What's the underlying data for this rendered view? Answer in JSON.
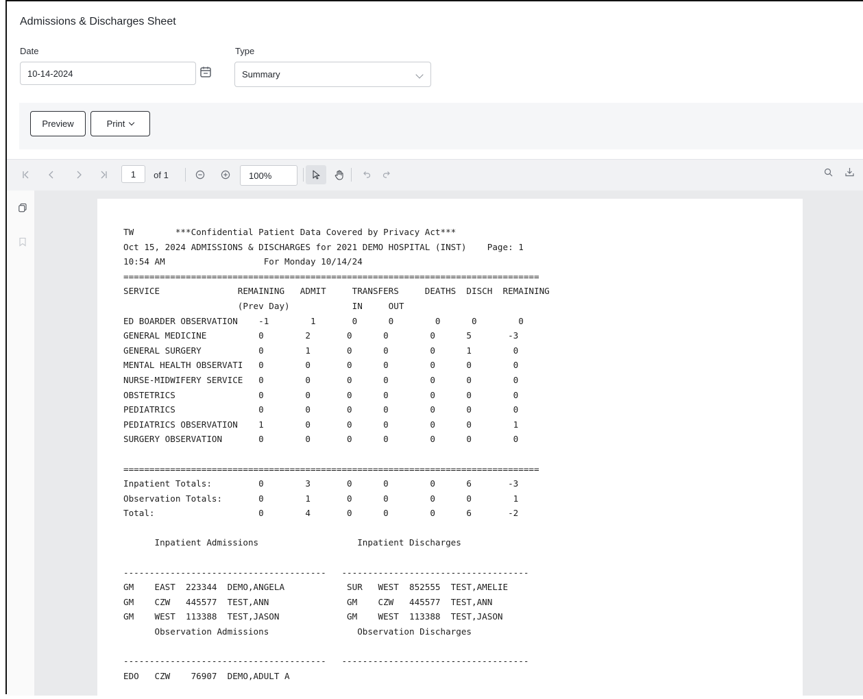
{
  "page": {
    "title": "Admissions & Discharges Sheet"
  },
  "form": {
    "date_label": "Date",
    "date_value": "10-14-2024",
    "type_label": "Type",
    "type_value": "Summary"
  },
  "actions": {
    "preview_label": "Preview",
    "print_label": "Print"
  },
  "viewer_toolbar": {
    "current_page": "1",
    "page_total": "of 1",
    "zoom": "100%"
  },
  "report": {
    "lines": [
      "TW        ***Confidential Patient Data Covered by Privacy Act***",
      "Oct 15, 2024 ADMISSIONS & DISCHARGES for 2021 DEMO HOSPITAL (INST)    Page: 1",
      "10:54 AM                   For Monday 10/14/24",
      "================================================================================",
      "SERVICE               REMAINING   ADMIT     TRANSFERS     DEATHS  DISCH  REMAINING",
      "                      (Prev Day)            IN     OUT",
      "ED BOARDER OBSERVATION    -1        1       0      0        0      0        0",
      "GENERAL MEDICINE          0        2       0      0        0      5       -3",
      "GENERAL SURGERY           0        1       0      0        0      1        0",
      "MENTAL HEALTH OBSERVATI   0        0       0      0        0      0        0",
      "NURSE-MIDWIFERY SERVICE   0        0       0      0        0      0        0",
      "OBSTETRICS                0        0       0      0        0      0        0",
      "PEDIATRICS                0        0       0      0        0      0        0",
      "PEDIATRICS OBSERVATION    1        0       0      0        0      0        1",
      "SURGERY OBSERVATION       0        0       0      0        0      0        0",
      "",
      "================================================================================",
      "Inpatient Totals:         0        3       0      0        0      6       -3",
      "Observation Totals:       0        1       0      0        0      0        1",
      "Total:                    0        4       0      0        0      6       -2",
      "",
      "      Inpatient Admissions                   Inpatient Discharges",
      "",
      "---------------------------------------   ------------------------------------",
      "GM    EAST  223344  DEMO,ANGELA            SUR   WEST  852555  TEST,AMELIE",
      "GM    CZW   445577  TEST,ANN               GM    CZW   445577  TEST,ANN",
      "GM    WEST  113388  TEST,JASON             GM    WEST  113388  TEST,JASON",
      "      Observation Admissions                 Observation Discharges",
      "",
      "---------------------------------------   ------------------------------------",
      "EDO   CZW    76907  DEMO,ADULT A"
    ]
  },
  "icons": {
    "calendar": "calendar-icon",
    "dropdown": "chevron-down-icon",
    "first_page": "first-page-icon",
    "prev_page": "prev-page-icon",
    "next_page": "next-page-icon",
    "last_page": "last-page-icon",
    "zoom_out": "zoom-out-icon",
    "zoom_in": "zoom-in-icon",
    "select_tool": "pointer-icon",
    "pan_tool": "hand-icon",
    "undo": "undo-icon",
    "redo": "redo-icon",
    "search": "search-icon",
    "download": "download-icon",
    "thumbnails": "thumbnails-icon",
    "bookmarks": "bookmark-icon"
  }
}
